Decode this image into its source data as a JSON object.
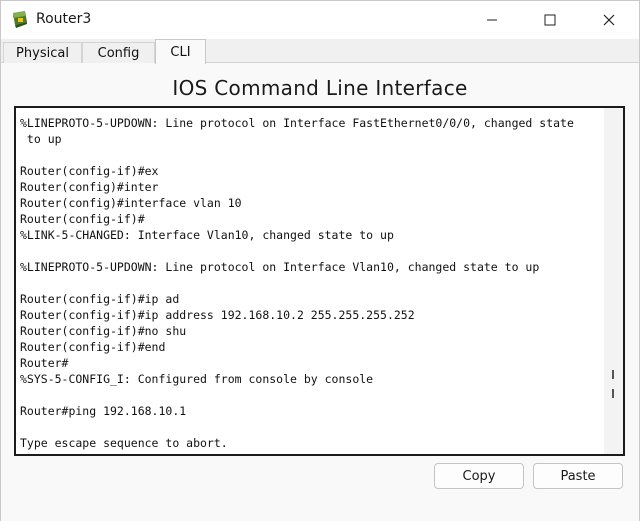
{
  "window": {
    "title": "Router3",
    "icon": "router-device-icon",
    "controls": [
      "minimize-icon",
      "maximize-icon",
      "close-icon"
    ]
  },
  "tabs": [
    {
      "label": "Physical"
    },
    {
      "label": "Config"
    },
    {
      "label": "CLI",
      "active": true
    }
  ],
  "cli": {
    "heading": "IOS Command Line Interface",
    "lines": [
      "%LINEPROTO-5-UPDOWN: Line protocol on Interface FastEthernet0/0/0, changed state",
      " to up",
      "",
      "Router(config-if)#ex",
      "Router(config)#inter",
      "Router(config)#interface vlan 10",
      "Router(config-if)#",
      "%LINK-5-CHANGED: Interface Vlan10, changed state to up",
      "",
      "%LINEPROTO-5-UPDOWN: Line protocol on Interface Vlan10, changed state to up",
      "",
      "Router(config-if)#ip ad",
      "Router(config-if)#ip address 192.168.10.2 255.255.255.252",
      "Router(config-if)#no shu",
      "Router(config-if)#end",
      "Router#",
      "%SYS-5-CONFIG_I: Configured from console by console",
      "",
      "Router#ping 192.168.10.1",
      "",
      "Type escape sequence to abort."
    ]
  },
  "buttons": {
    "copy_label": "Copy",
    "paste_label": "Paste"
  }
}
